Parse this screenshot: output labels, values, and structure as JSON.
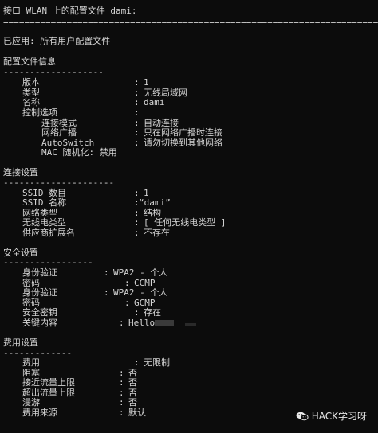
{
  "header": {
    "title": "接口 WLAN 上的配置文件 dami:",
    "divider": "======================================================================="
  },
  "applied": "已应用: 所有用户配置文件",
  "profile_info": {
    "heading": "配置文件信息",
    "underline": "-------------------",
    "rows": [
      {
        "label": "版本",
        "sep": ":",
        "value": "1"
      },
      {
        "label": "类型",
        "sep": ":",
        "value": "无线局域网"
      },
      {
        "label": "名称",
        "sep": ":",
        "value": "dami"
      },
      {
        "label": "控制选项",
        "sep": ":",
        "value": ""
      }
    ],
    "control_options": [
      {
        "label": "连接模式",
        "sep": ":",
        "value": "自动连接"
      },
      {
        "label": "网络广播",
        "sep": ":",
        "value": "只在网络广播时连接"
      },
      {
        "label": "AutoSwitch",
        "sep": ":",
        "value": "请勿切换到其他网络"
      },
      {
        "label": "MAC 随机化: 禁用",
        "sep": "",
        "value": ""
      }
    ]
  },
  "connection_settings": {
    "heading": "连接设置",
    "underline": "---------------------",
    "rows": [
      {
        "label": "SSID 数目",
        "sep": ":",
        "value": "1"
      },
      {
        "label": "SSID 名称",
        "sep": ":",
        "value": "“dami”"
      },
      {
        "label": "网络类型",
        "sep": ":",
        "value": "结构"
      },
      {
        "label": "无线电类型",
        "sep": ":",
        "value": "[ 任何无线电类型 ]"
      },
      {
        "label": "供应商扩展名",
        "sep": ":",
        "value": "不存在"
      }
    ]
  },
  "security_settings": {
    "heading": "安全设置",
    "underline": "-----------------",
    "rows": [
      {
        "label": "身份验证",
        "sep": ":",
        "value": "WPA2 - 个人"
      },
      {
        "label": "密码",
        "sep": ":",
        "value": "CCMP"
      },
      {
        "label": "身份验证",
        "sep": ":",
        "value": "WPA2 - 个人"
      },
      {
        "label": "密码",
        "sep": ":",
        "value": "GCMP"
      },
      {
        "label": "安全密钥",
        "sep": ":",
        "value": "存在"
      },
      {
        "label": "关键内容",
        "sep": ":",
        "value": "Hello"
      }
    ]
  },
  "cost_settings": {
    "heading": "费用设置",
    "underline": "-------------",
    "rows": [
      {
        "label": "费用",
        "sep": ":",
        "value": "无限制"
      },
      {
        "label": "阻塞",
        "sep": ":",
        "value": "否"
      },
      {
        "label": "接近流量上限",
        "sep": ":",
        "value": "否"
      },
      {
        "label": "超出流量上限",
        "sep": ":",
        "value": "否"
      },
      {
        "label": "漫游",
        "sep": ":",
        "value": "否"
      },
      {
        "label": "费用来源",
        "sep": ":",
        "value": "默认"
      }
    ]
  },
  "watermark": {
    "text": "HACK学习呀",
    "icon": "wechat-icon"
  }
}
